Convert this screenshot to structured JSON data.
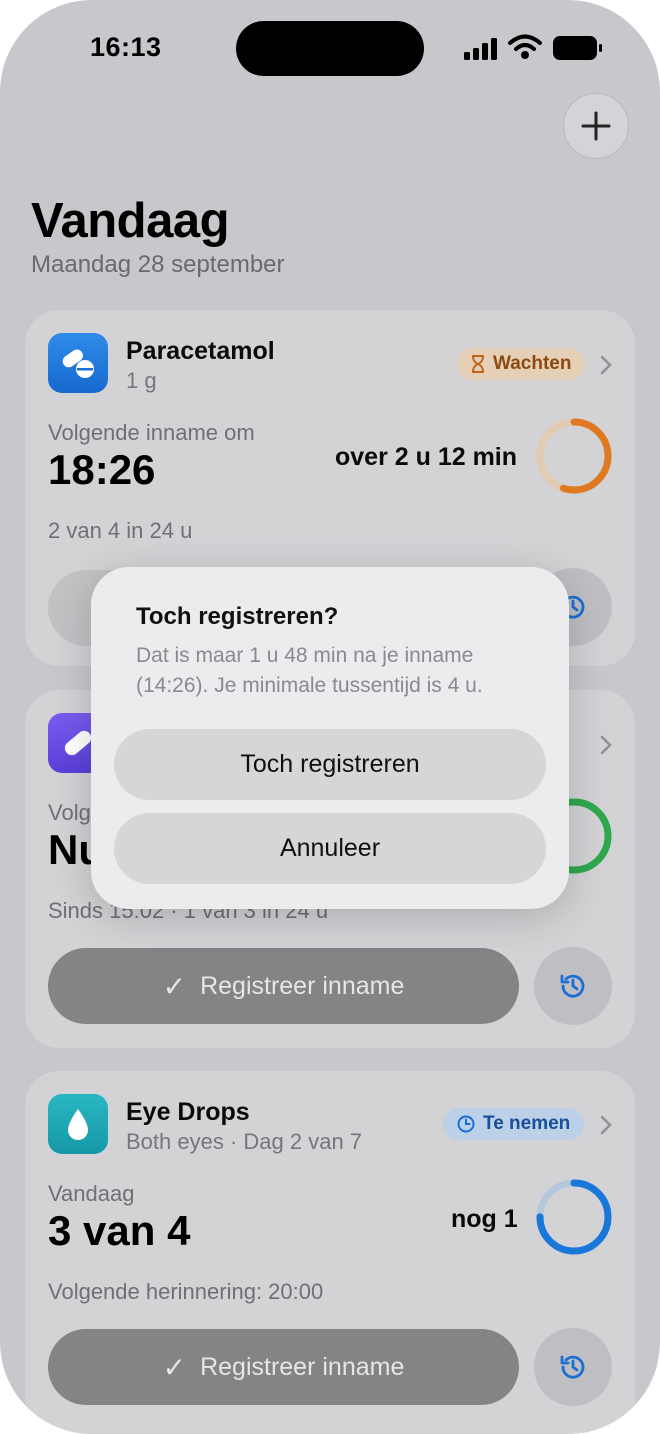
{
  "status_bar": {
    "time": "16:13"
  },
  "header": {
    "title": "Vandaag",
    "date": "Maandag 28 september"
  },
  "cards": [
    {
      "name": "Paracetamol",
      "sub": "1 g",
      "badge": "Wachten",
      "badge_icon": "hourglass-icon",
      "label": "Volgende inname om",
      "value": "18:26",
      "right": "over 2 u 12 min",
      "footer": "2 van 4 in 24 u",
      "ring_progress": 0.55,
      "ring_color": "#e07a22"
    },
    {
      "name": "",
      "label_fragment": "Volg",
      "value_fragment": "Nu",
      "footer": "Sinds 15:02 · 1 van 3 in 24 u",
      "button_label": "Registreer inname",
      "ring_color": "#2fa84f"
    },
    {
      "name": "Eye Drops",
      "sub": "Both eyes · Dag 2 van 7",
      "badge": "Te nemen",
      "badge_icon": "clock-icon",
      "label": "Vandaag",
      "value": "3 van 4",
      "right": "nog 1",
      "footer": "Volgende herinnering: 20:00",
      "button_label": "Registreer inname",
      "ring_progress": 0.75,
      "ring_color": "#1877d8"
    }
  ],
  "dialog": {
    "title": "Toch registreren?",
    "message": "Dat is maar 1 u 48 min na je inname (14:26). Je minimale tussentijd is 4 u.",
    "confirm": "Toch registreren",
    "cancel": "Annuleer"
  },
  "colors": {
    "orange": "#e07a22",
    "green": "#2fa84f",
    "blue": "#1877d8"
  }
}
